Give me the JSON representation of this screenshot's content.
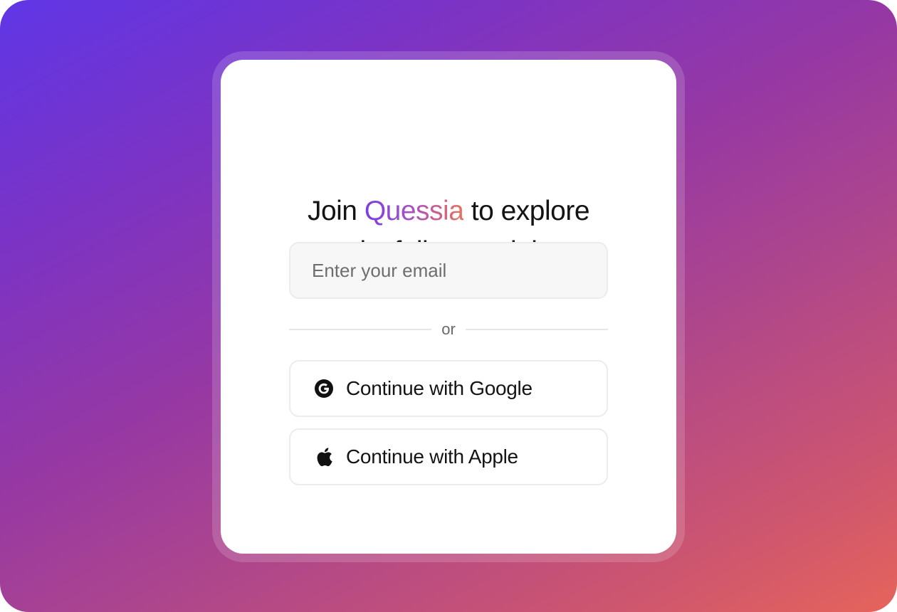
{
  "headline": {
    "line1_before": "Join ",
    "brand": "Quessia",
    "line1_after": " to explore",
    "line2": "its full potential"
  },
  "email": {
    "placeholder": "Enter your email",
    "value": ""
  },
  "divider": {
    "text": "or"
  },
  "buttons": {
    "google": {
      "label": "Continue with Google",
      "icon": "google-icon"
    },
    "apple": {
      "label": "Continue with Apple",
      "icon": "apple-icon"
    }
  },
  "colors": {
    "brand_gradient_start": "#7a3fe0",
    "brand_gradient_end": "#e8725e",
    "background_start": "#5f36e6",
    "background_end": "#e6645b"
  }
}
